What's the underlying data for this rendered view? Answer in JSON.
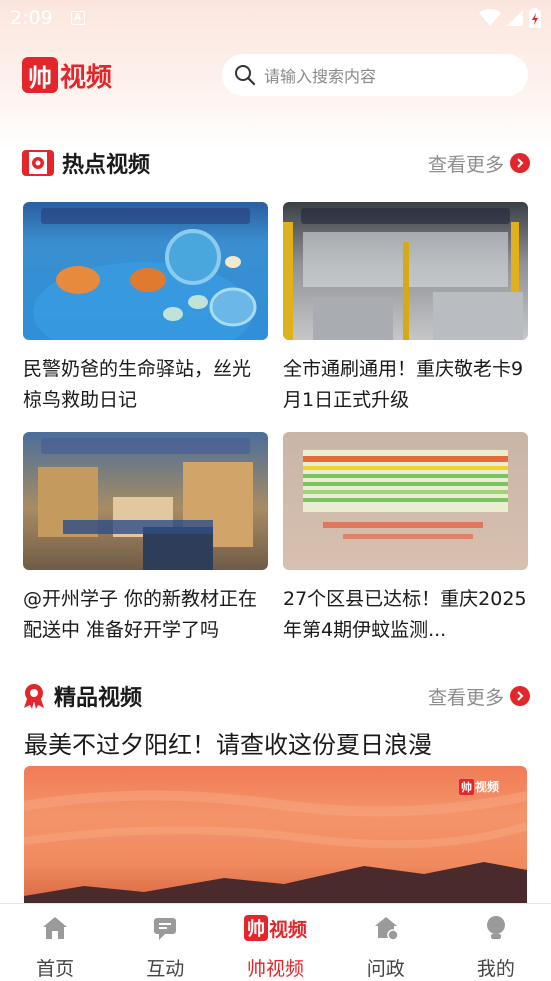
{
  "status_bar": {
    "time": "2:09",
    "a_icon_letter": "A"
  },
  "header": {
    "logo_text_1": "帅",
    "logo_text_2": "视频",
    "search_placeholder": "请输入搜索内容"
  },
  "hot_section": {
    "title": "热点视频",
    "more_label": "查看更多",
    "items": [
      {
        "title": "民警奶爸的生命驿站，丝光椋鸟救助日记"
      },
      {
        "title": "全市通刷通用！重庆敬老卡9月1日正式升级"
      },
      {
        "title": "@开州学子 你的新教材正在配送中 准备好开学了吗"
      },
      {
        "title": "27个区县已达标！重庆2025年第4期伊蚊监测..."
      }
    ]
  },
  "premium_section": {
    "title": "精品视频",
    "more_label": "查看更多",
    "feature_title": "最美不过夕阳红！请查收这份夏日浪漫",
    "thumb_logo_1": "帅",
    "thumb_logo_2": "视频"
  },
  "tabbar": {
    "tabs": [
      {
        "label": "首页"
      },
      {
        "label": "互动"
      },
      {
        "label": "帅视频"
      },
      {
        "label": "问政"
      },
      {
        "label": "我的"
      }
    ],
    "logo_text_1": "帅",
    "logo_text_2": "视频"
  },
  "colors": {
    "accent": "#e3262b",
    "muted": "#8d8d8d"
  }
}
